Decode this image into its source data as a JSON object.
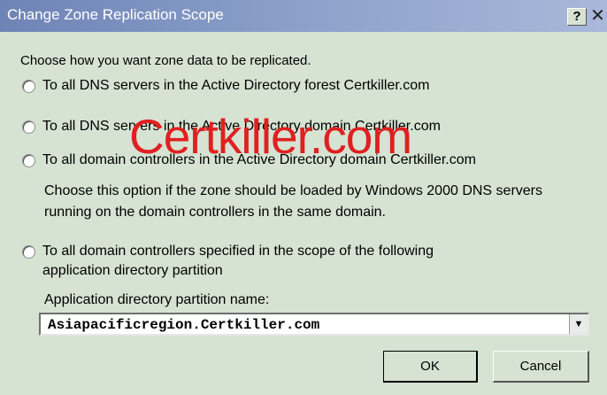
{
  "window": {
    "title": "Change Zone Replication Scope",
    "help_label": "?",
    "close_label": "✕"
  },
  "intro": "Choose how you want zone data to be replicated.",
  "options": [
    {
      "label": "To all DNS servers in the Active Directory forest Certkiller.com",
      "selected": false
    },
    {
      "label": "To all DNS servers in the Active Directory domain Certkiller.com",
      "selected": false
    },
    {
      "label": "To all domain controllers in the Active Directory domain Certkiller.com",
      "selected": false
    },
    {
      "label": "To all domain controllers specified in the scope of the following",
      "label_line2": "application directory partition",
      "selected": false
    }
  ],
  "option3_note": "Choose this option if the zone should be loaded by Windows 2000 DNS servers running on the domain controllers in the same domain.",
  "partition": {
    "label": "Application directory partition name:",
    "value": "Asiapacificregion.Certkiller.com",
    "arrow": "▼"
  },
  "buttons": {
    "ok": "OK",
    "cancel": "Cancel"
  },
  "watermark": "Certkiller.com",
  "colors": {
    "titlebar": "#7a8fc0",
    "dialog_bg": "#d6e2d2",
    "watermark": "#e02020"
  }
}
